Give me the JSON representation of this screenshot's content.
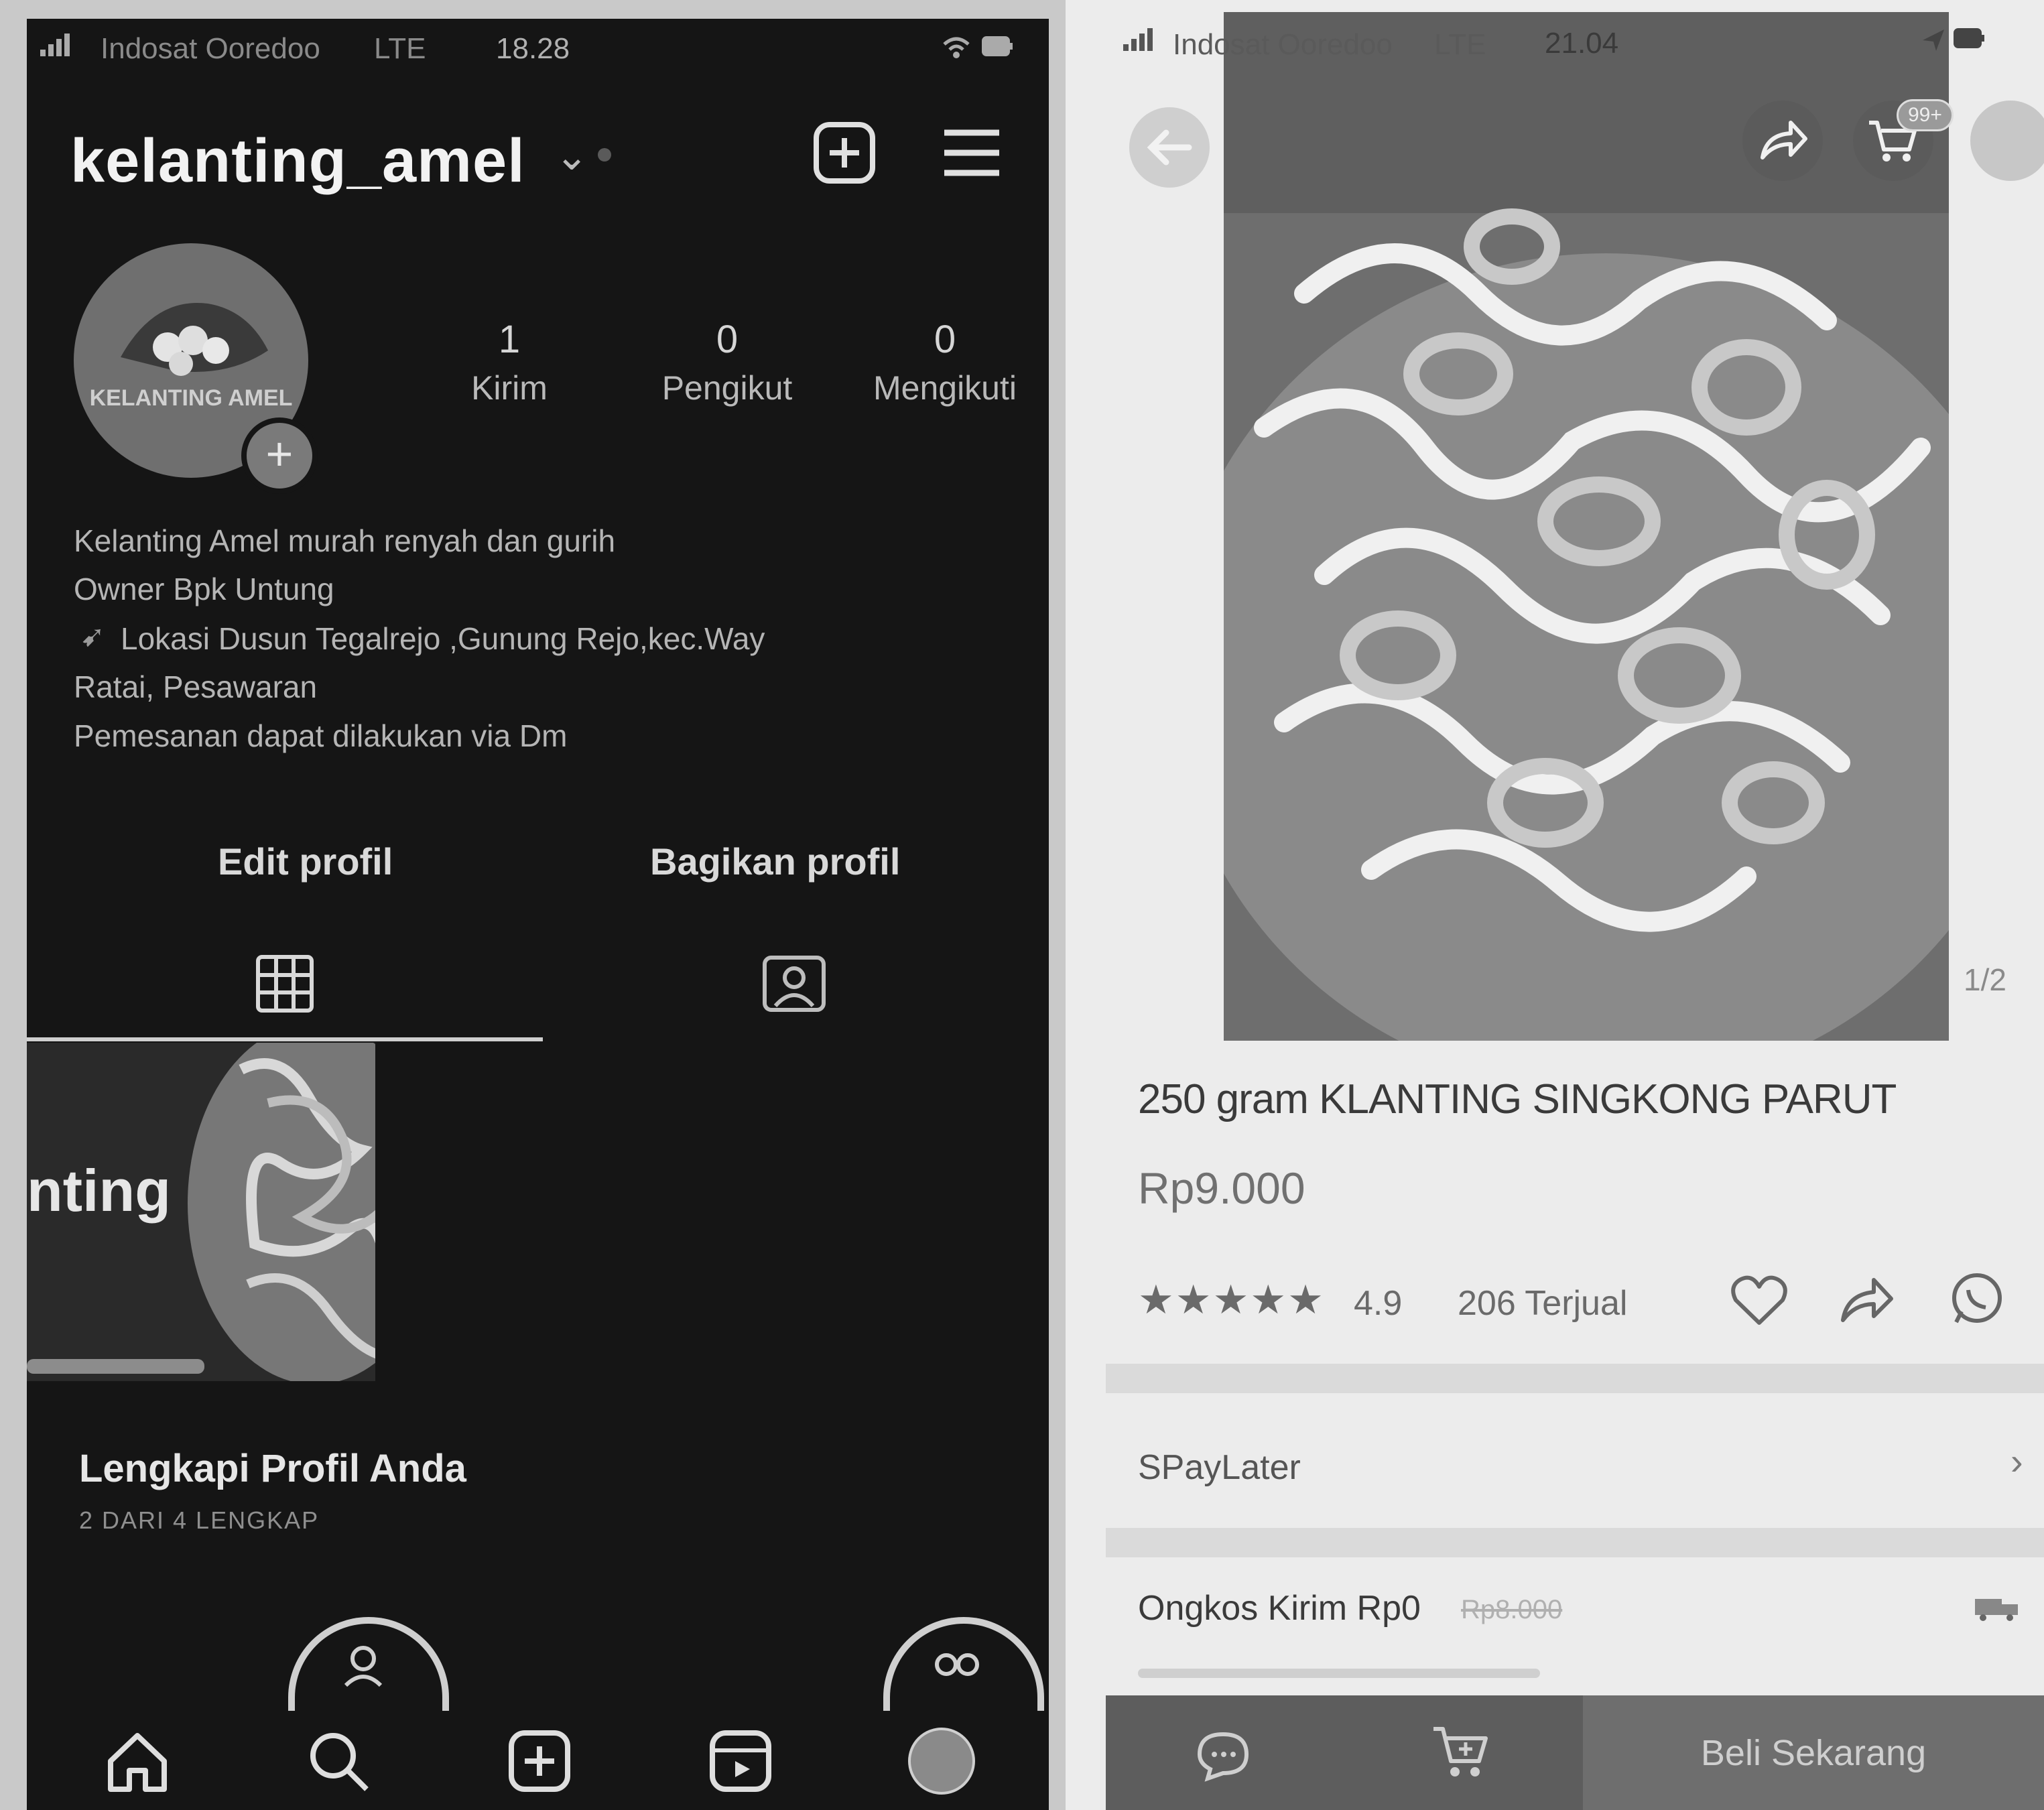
{
  "left": {
    "status": {
      "carrier": "Indosat Ooredoo",
      "network": "LTE",
      "time": "18.28"
    },
    "header": {
      "username": "kelanting_amel",
      "caret": "⌄"
    },
    "avatar_text": "KELANTING AMEL",
    "stats": [
      {
        "value": "1",
        "label": "Kirim"
      },
      {
        "value": "0",
        "label": "Pengikut"
      },
      {
        "value": "0",
        "label": "Mengikuti"
      }
    ],
    "bio": [
      "Kelanting Amel murah renyah dan gurih",
      "Owner Bpk Untung",
      "Lokasi Dusun Tegalrejo ,Gunung Rejo,kec.Way",
      "Ratai, Pesawaran",
      "Pemesanan dapat dilakukan via Dm"
    ],
    "buttons": {
      "edit": "Edit profil",
      "share": "Bagikan profil"
    },
    "post_text": "nting",
    "complete": {
      "title": "Lengkapi Profil Anda",
      "sub": "2 DARI 4 LENGKAP"
    },
    "icons": [
      "grid-icon",
      "tagged-icon",
      "home-icon",
      "search-icon",
      "add-icon",
      "reels-icon",
      "profile-icon"
    ]
  },
  "right": {
    "status": {
      "carrier": "Indosat Ooredoo",
      "network": "LTE",
      "time": "21.04"
    },
    "cart_badge": "99+",
    "image_counter": "1/2",
    "product": {
      "title": "250 gram KLANTING SINGKONG PARUT",
      "price": "Rp9.000",
      "stars": "★★★★★",
      "rating": "4.9",
      "sold": "206 Terjual"
    },
    "rows": {
      "paylater": "SPayLater",
      "shipping": "Ongkos Kirim Rp0",
      "shipping_old": "Rp8.000"
    },
    "buy_now": "Beli Sekarang"
  }
}
